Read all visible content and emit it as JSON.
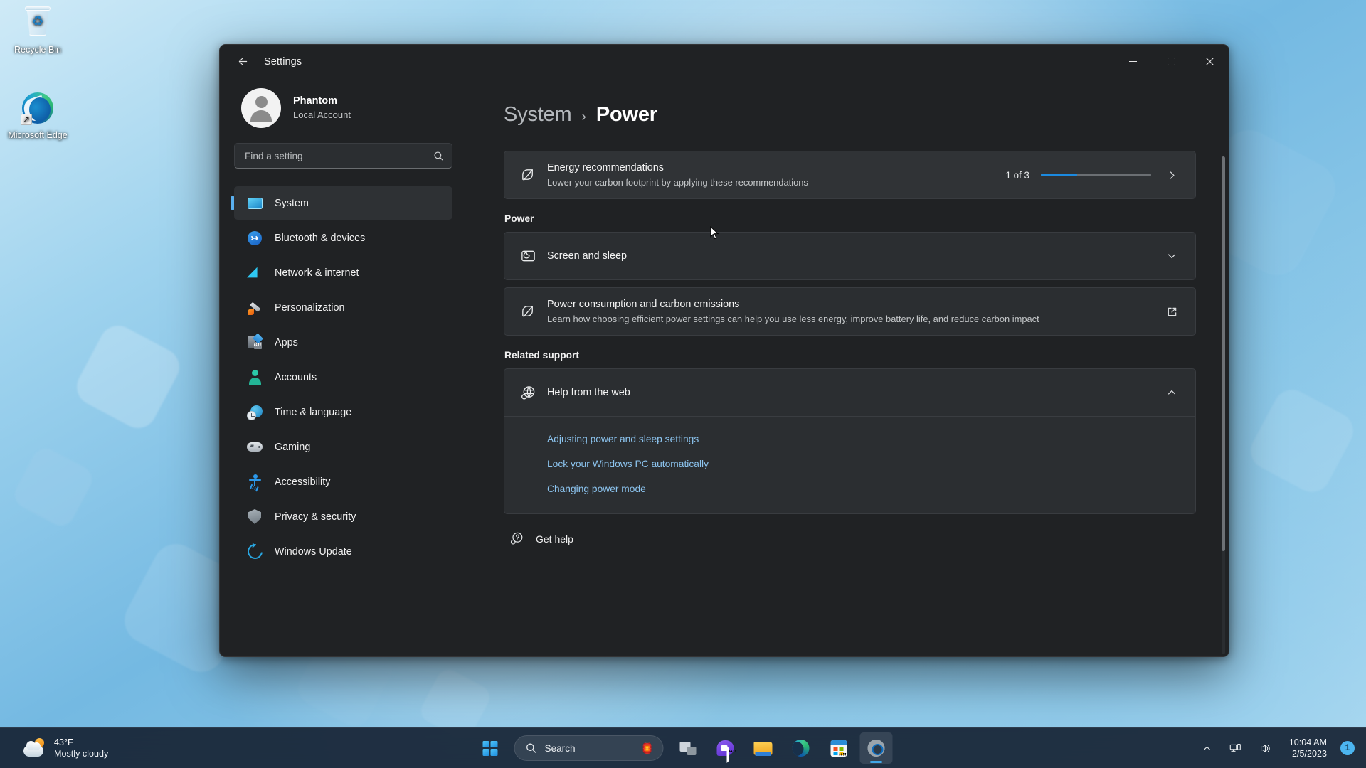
{
  "desktop": {
    "icons": [
      {
        "name": "Recycle Bin",
        "icon": "recycle-bin-icon"
      },
      {
        "name": "Microsoft Edge",
        "icon": "edge-icon"
      }
    ]
  },
  "window": {
    "title": "Settings",
    "back_tooltip": "Back",
    "controls": {
      "minimize": "─",
      "maximize": "☐",
      "close": "✕"
    }
  },
  "sidebar": {
    "profile": {
      "name": "Phantom",
      "account_type": "Local Account",
      "avatar": "user-avatar"
    },
    "search": {
      "placeholder": "Find a setting",
      "value": "",
      "icon": "search-icon"
    },
    "items": [
      {
        "label": "System",
        "icon": "system-icon",
        "selected": true
      },
      {
        "label": "Bluetooth & devices",
        "icon": "bluetooth-icon",
        "selected": false
      },
      {
        "label": "Network & internet",
        "icon": "wifi-icon",
        "selected": false
      },
      {
        "label": "Personalization",
        "icon": "paintbrush-icon",
        "selected": false
      },
      {
        "label": "Apps",
        "icon": "apps-icon",
        "selected": false
      },
      {
        "label": "Accounts",
        "icon": "accounts-icon",
        "selected": false
      },
      {
        "label": "Time & language",
        "icon": "clock-globe-icon",
        "selected": false
      },
      {
        "label": "Gaming",
        "icon": "gamepad-icon",
        "selected": false
      },
      {
        "label": "Accessibility",
        "icon": "accessibility-icon",
        "selected": false
      },
      {
        "label": "Privacy & security",
        "icon": "shield-icon",
        "selected": false
      },
      {
        "label": "Windows Update",
        "icon": "update-refresh-icon",
        "selected": false
      }
    ]
  },
  "main": {
    "breadcrumb": {
      "parent": "System",
      "separator": "›",
      "current": "Power"
    },
    "energy_card": {
      "title": "Energy recommendations",
      "subtitle": "Lower your carbon footprint by applying these recommendations",
      "icon": "leaf-eco-icon",
      "count_label": "1 of 3",
      "progress_percent": 33,
      "progress_color": "#1b8ae0",
      "chevron": "chevron-right-icon"
    },
    "power_section": {
      "heading": "Power",
      "items": [
        {
          "title": "Screen and sleep",
          "subtitle": "",
          "icon": "screen-sleep-icon",
          "action_icon": "chevron-down-icon"
        },
        {
          "title": "Power consumption and carbon emissions",
          "subtitle": "Learn how choosing efficient power settings can help you use less energy, improve battery life, and reduce carbon impact",
          "icon": "leaf-eco-icon",
          "action_icon": "external-link-icon"
        }
      ]
    },
    "related_support": {
      "heading": "Related support",
      "expander": {
        "title": "Help from the web",
        "icon": "globe-help-icon",
        "action_icon": "chevron-up-icon",
        "expanded": true,
        "links": [
          "Adjusting power and sleep settings",
          "Lock your Windows PC automatically",
          "Changing power mode"
        ]
      },
      "get_help": {
        "label": "Get help",
        "icon": "get-help-icon"
      }
    }
  },
  "taskbar": {
    "weather": {
      "temperature": "43°F",
      "condition": "Mostly cloudy",
      "icon": "partly-cloudy-icon"
    },
    "start": {
      "label": "Start",
      "icon": "windows-start-icon"
    },
    "search": {
      "label": "Search",
      "icon": "search-icon",
      "decoration": "🏮"
    },
    "apps": [
      {
        "name": "Task View",
        "icon": "task-view-icon",
        "active": false
      },
      {
        "name": "Chat",
        "icon": "chat-icon",
        "active": false
      },
      {
        "name": "File Explorer",
        "icon": "file-explorer-icon",
        "active": false
      },
      {
        "name": "Microsoft Edge",
        "icon": "edge-icon",
        "active": false
      },
      {
        "name": "Microsoft Store",
        "icon": "microsoft-store-icon",
        "active": false
      },
      {
        "name": "Settings",
        "icon": "settings-gear-icon",
        "active": true
      }
    ],
    "tray": {
      "show_hidden": "chevron-up-icon",
      "network": "network-icon",
      "volume": "volume-icon",
      "time": "10:04 AM",
      "date": "2/5/2023",
      "notification_count": "1"
    }
  },
  "colors": {
    "accent": "#0078d4",
    "window_bg": "#202224",
    "card_bg": "#2b2e31",
    "link": "#8cc4ef"
  }
}
